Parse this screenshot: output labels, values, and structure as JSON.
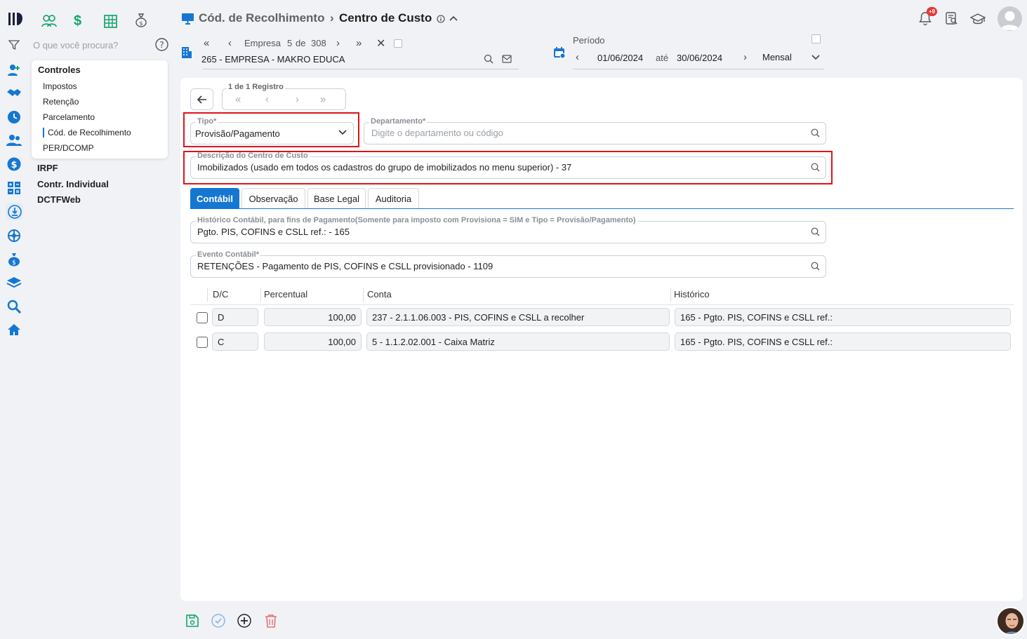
{
  "search": {
    "placeholder": "O que você procura?"
  },
  "menu": {
    "group_title": "Controles",
    "items": [
      "Impostos",
      "Retenção",
      "Parcelamento",
      "Cód. de Recolhimento",
      "PER/DCOMP"
    ],
    "sections": [
      "IRPF",
      "Contr. Individual",
      "DCTFWeb"
    ]
  },
  "header": {
    "breadcrumb_parent": "Cód. de Recolhimento",
    "breadcrumb_sep": "›",
    "breadcrumb_current": "Centro de Custo",
    "notification_badge": "+9"
  },
  "empresa": {
    "label": "Empresa",
    "index": "5",
    "de": "de",
    "total": "308",
    "name": "265 - EMPRESA - MAKRO EDUCA"
  },
  "periodo": {
    "label": "Período",
    "start": "01/06/2024",
    "ate": "até",
    "end": "30/06/2024",
    "mode": "Mensal"
  },
  "record_nav": {
    "label": "1 de 1 Registro"
  },
  "form": {
    "tipo_label": "Tipo*",
    "tipo_value": "Provisão/Pagamento",
    "departamento_label": "Departamento*",
    "departamento_placeholder": "Digite o departamento ou código",
    "descricao_label": "Descrição do Centro de Custo",
    "descricao_value": "Imobilizados (usado em todos os cadastros do grupo de imobilizados no menu superior) - 37"
  },
  "tabs": [
    "Contábil",
    "Observação",
    "Base Legal",
    "Auditoria"
  ],
  "contabil": {
    "historico_label": "Histórico Contábil, para fins de Pagamento(Somente para imposto com Provisiona = SIM e Tipo = Provisão/Pagamento)",
    "historico_value": "Pgto. PIS, COFINS e CSLL ref.: - 165",
    "evento_label": "Evento Contábil*",
    "evento_value": "RETENÇÕES - Pagamento de PIS, COFINS e CSLL provisionado - 1109"
  },
  "table": {
    "headers": [
      "D/C",
      "Percentual",
      "Conta",
      "Histórico"
    ],
    "rows": [
      {
        "dc": "D",
        "percentual": "100,00",
        "conta": "237 - 2.1.1.06.003 - PIS, COFINS e CSLL a recolher",
        "historico": "165 - Pgto. PIS, COFINS e CSLL ref.:"
      },
      {
        "dc": "C",
        "percentual": "100,00",
        "conta": "5 - 1.1.2.02.001 - Caixa Matriz",
        "historico": "165 - Pgto. PIS, COFINS e CSLL ref.:"
      }
    ]
  },
  "colors": {
    "accent": "#1677d2",
    "green": "#14a66a",
    "highlight": "#e0131a"
  }
}
